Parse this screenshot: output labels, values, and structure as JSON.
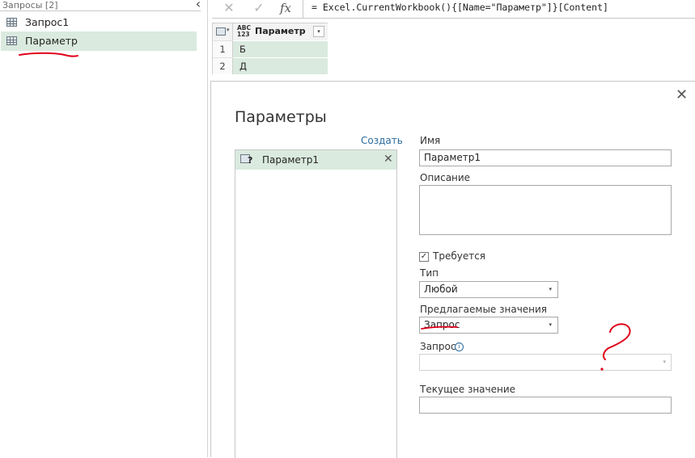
{
  "left_pane": {
    "header": "Запросы [2]",
    "collapse_glyph": "‹",
    "queries": [
      {
        "label": "Запрос1",
        "selected": false
      },
      {
        "label": "Параметр",
        "selected": true
      }
    ]
  },
  "formula_bar": {
    "cancel_glyph": "✕",
    "confirm_glyph": "✓",
    "fx_glyph": "fx",
    "formula": "= Excel.CurrentWorkbook(){[Name=\"Параметр\"]}[Content]"
  },
  "grid": {
    "type_icon_top": "ABC",
    "type_icon_bottom": "123",
    "column": "Параметр",
    "filter_glyph": "▾",
    "rows": [
      {
        "num": "1",
        "value": "Б"
      },
      {
        "num": "2",
        "value": "Д"
      }
    ]
  },
  "dialog": {
    "title": "Параметры",
    "create_link": "Создать",
    "close_glyph": "✕",
    "parameter": {
      "name": "Параметр1",
      "icon_mark": "?",
      "remove_glyph": "✕"
    },
    "fields": {
      "name_label": "Имя",
      "name_value": "Параметр1",
      "description_label": "Описание",
      "description_value": "",
      "required_label": "Требуется",
      "required_checked": "✓",
      "type_label": "Тип",
      "type_value": "Любой",
      "suggested_label": "Предлагаемые значения",
      "suggested_value": "Запрос",
      "query_label": "Запрос",
      "info_glyph": "i",
      "query_value": "",
      "current_label": "Текущее значение",
      "current_value": ""
    },
    "dropdown_arrow": "▾"
  },
  "colors": {
    "selection_green": "#daeadf",
    "link_blue": "#2a6a9c",
    "annotation_red": "#e0001a"
  },
  "icons": [
    "table-icon",
    "close-icon",
    "checkmark-icon",
    "fx-icon",
    "info-icon",
    "parameter-icon",
    "dropdown-arrow-icon"
  ]
}
